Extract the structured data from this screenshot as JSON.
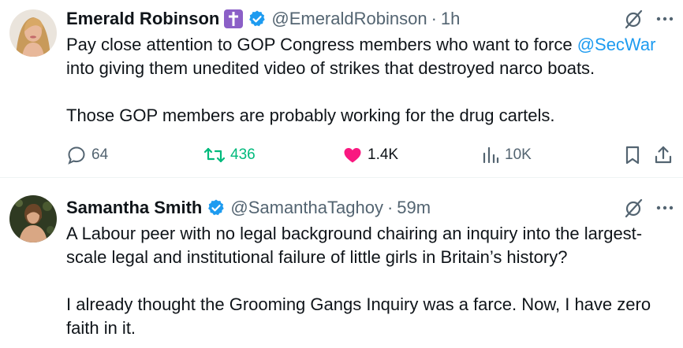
{
  "tweets": [
    {
      "author_name": "Emerald Robinson",
      "handle": "@EmeraldRobinson",
      "separator": "·",
      "time": "1h",
      "text_lines": [
        [
          {
            "t": "Pay close attention to GOP Congress members who want to force "
          },
          {
            "t": "@SecWar",
            "mention": true
          }
        ],
        "into giving them unedited video of strikes that destroyed narco boats.",
        "Those GOP members are probably working for the drug cartels."
      ],
      "stats": {
        "replies": "64",
        "retweets": "436",
        "likes": "1.4K",
        "views": "10K"
      },
      "badges": [
        "cross-badge-icon",
        "verified-badge-icon"
      ]
    },
    {
      "author_name": "Samantha Smith",
      "handle": "@SamanthaTaghoy",
      "separator": "·",
      "time": "59m",
      "text_lines": [
        "A Labour peer with no legal background chairing an inquiry into the largest-",
        "scale legal and institutional failure of little girls in Britain’s history?",
        "I already thought the Grooming Gangs Inquiry was a farce. Now, I have zero",
        "faith in it."
      ],
      "badges": [
        "verified-badge-icon"
      ]
    }
  ],
  "colors": {
    "accent": "#1d9bf0",
    "retweet": "#00ba7c",
    "like": "#f91880",
    "muted": "#536471",
    "cross_badge": "#8b5fc7"
  }
}
